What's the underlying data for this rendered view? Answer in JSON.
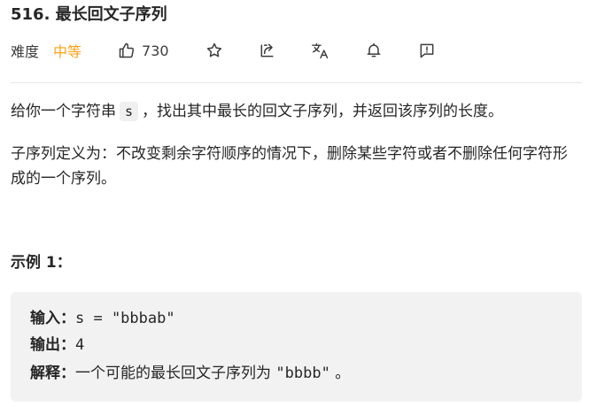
{
  "problem": {
    "title": "516. 最长回文子序列"
  },
  "meta": {
    "difficulty_label": "难度",
    "difficulty_value": "中等",
    "like_count": "730",
    "icons": [
      "thumbs-up-icon",
      "star-icon",
      "share-icon",
      "translate-icon",
      "bell-icon",
      "feedback-icon"
    ],
    "colors": {
      "difficulty": "#ffa116",
      "text": "#262626",
      "divider": "#e6e6e6",
      "example_bg": "#f2f2f2"
    }
  },
  "description": {
    "p1_before": "给你一个字符串",
    "p1_code": "s",
    "p1_after": "，找出其中最长的回文子序列，并返回该序列的长度。",
    "p2": "子序列定义为：不改变剩余字符顺序的情况下，删除某些字符或者不删除任何字符形成的一个序列。"
  },
  "example": {
    "title": "示例 1：",
    "input_label": "输入：",
    "input_value": "s = \"bbbab\"",
    "output_label": "输出：",
    "output_value": "4",
    "explanation_label": "解释：",
    "explanation_text": "一个可能的最长回文子序列为",
    "explanation_code": "\"bbbb\"",
    "explanation_end": " 。"
  }
}
